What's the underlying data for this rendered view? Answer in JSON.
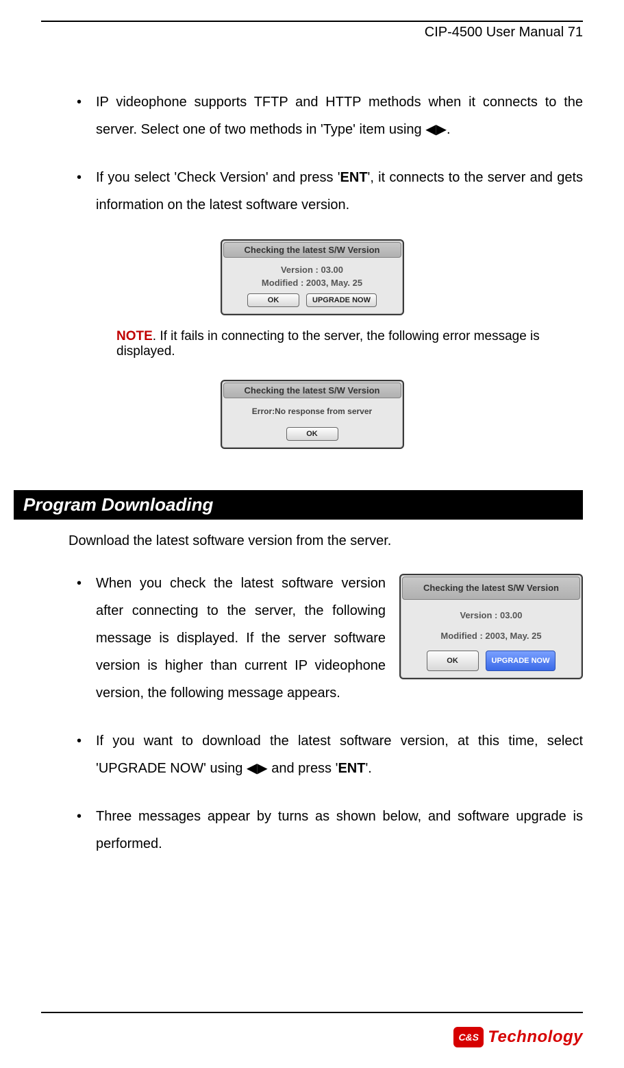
{
  "header": {
    "title": "CIP-4500 User Manual",
    "page": "71"
  },
  "bullets_top": {
    "b1_pre": "IP videophone supports TFTP and HTTP methods when it connects to the server. Select one of two methods in 'Type' item using ",
    "b1_arrows": "◀▶",
    "b1_post": ".",
    "b2_pre": "If you select 'Check Version' and press '",
    "b2_ent": "ENT",
    "b2_post": "', it connects to the server and gets information on the latest software version."
  },
  "dialog1": {
    "title": "Checking the latest S/W Version",
    "line1": "Version : 03.00",
    "line2": "Modified : 2003, May. 25",
    "ok": "OK",
    "upgrade": "UPGRADE NOW"
  },
  "note": {
    "label": "NOTE",
    "text": ". If it fails in connecting to the server, the following error message is displayed."
  },
  "dialog2": {
    "title": "Checking the latest S/W Version",
    "err": "Error:No response from server",
    "ok": "OK"
  },
  "section": {
    "title": "Program Downloading",
    "intro": "Download the latest software version from the server."
  },
  "bullets_bottom": {
    "b1": "When you check the latest software version after connecting to the server, the following message is displayed. If the server software version is higher than current IP videophone version, the following message appears.",
    "b2_pre": "If you want to download the latest software version, at this time, select 'UPGRADE NOW' using ",
    "b2_arrows": "◀▶",
    "b2_mid": " and press '",
    "b2_ent": "ENT",
    "b2_post": "'.",
    "b3": "Three messages appear by turns as shown below, and software upgrade is performed."
  },
  "dialog3": {
    "title": "Checking the latest S/W Version",
    "line1": "Version : 03.00",
    "line2": "Modified : 2003, May. 25",
    "ok": "OK",
    "upgrade": "UPGRADE NOW"
  },
  "footer": {
    "badge": "C&S",
    "brand": "Technology"
  }
}
